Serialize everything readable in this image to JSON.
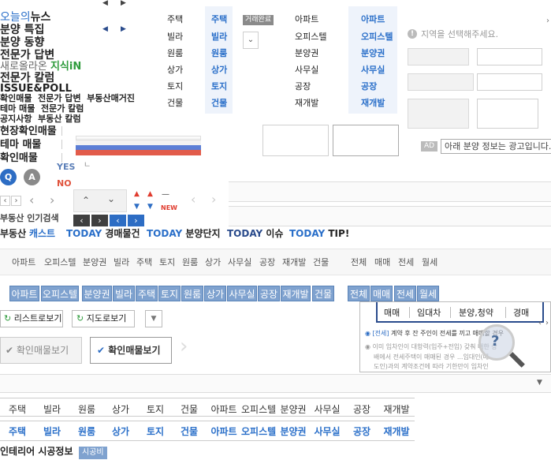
{
  "left_menu": {
    "items": [
      {
        "prefix": "오늘의",
        "label": "뉴스"
      },
      {
        "label": "분양 특집"
      },
      {
        "label": "분양 동향"
      },
      {
        "label": "전문가 답변"
      },
      {
        "prefix": "새로올라온",
        "label": "지식iN"
      },
      {
        "label": "전문가 칼럼"
      },
      {
        "label": "ISSUE&POLL"
      }
    ],
    "subline1": [
      "확인매물",
      "전문가 답변",
      "부동산매거진"
    ],
    "subline2": [
      "테마 매물",
      "전문가 칼럼"
    ],
    "subline3": [
      "공지사항",
      "부동산 칼럼"
    ],
    "sections": [
      "현장확인매물",
      "테마 매물",
      "확인매물"
    ],
    "badges": [
      "Q",
      "A"
    ],
    "yes": "YES",
    "no": "NO",
    "hot_search": "부동산 인기검색",
    "new_label": "NEW"
  },
  "today_bar": {
    "cast_prefix": "부동산",
    "cast_label": "캐스트",
    "items": [
      {
        "today": "TODAY",
        "label": "경매물건"
      },
      {
        "today": "TODAY",
        "label": "분양단지"
      },
      {
        "today": "TODAY",
        "label": "이슈"
      },
      {
        "today": "TODAY",
        "label": "TIP!"
      }
    ]
  },
  "type_grid": {
    "col1": [
      "주택",
      "빌라",
      "원룸",
      "상가",
      "토지",
      "건물"
    ],
    "col2": [
      "주택",
      "빌라",
      "원룸",
      "상가",
      "토지",
      "건물"
    ],
    "complete_label": "거래완료",
    "col3": [
      "아파트",
      "오피스텔",
      "분양권",
      "사무실",
      "공장",
      "재개발"
    ],
    "col4": [
      "아파트",
      "오피스텔",
      "분양권",
      "사무실",
      "공장",
      "재개발"
    ]
  },
  "right_panel": {
    "notice": "지역을 선택해주세요.",
    "ad_badge": "AD",
    "ad_text": "아래 분양 정보는 광고입니다."
  },
  "filter_text": [
    "아파트",
    "오피스텔",
    "분양권",
    "빌라",
    "주택",
    "토지",
    "원룸",
    "상가",
    "사무실",
    "공장",
    "재개발",
    "건물"
  ],
  "deal_text": [
    "전체",
    "매매",
    "전세",
    "월세"
  ],
  "filter_chips": [
    "아파트",
    "오피스텔",
    "분양권",
    "빌라",
    "주택",
    "토지",
    "원룸",
    "상가",
    "사무실",
    "공장",
    "재개발",
    "건물"
  ],
  "deal_chips": [
    "전체",
    "매매",
    "전세",
    "월세"
  ],
  "buttons": {
    "list_view": "리스트로보기",
    "map_view": "지도로보기",
    "verified_gray": "확인매물보기",
    "verified_active": "확인매물보기"
  },
  "info_popup": {
    "tabs": [
      "매매",
      "임대차",
      "분양,청약",
      "경매"
    ],
    "line1_tag": "[전세]",
    "line1": "계약 후 잔 주인이 전세를 끼고 매매할 경우",
    "line2": "이미 임차인이 대항력(입주+전입) 갖춰 대한 상",
    "line3": "배에서 전세주택이 매매된 경우 ...임대인(매",
    "line4": "도인)과의 계약조건에 따라 기한만이 임차인"
  },
  "bottom_table": {
    "row1": [
      "주택",
      "빌라",
      "원룸",
      "상가",
      "토지",
      "건물",
      "아파트",
      "오피스텔",
      "분양권",
      "사무실",
      "공장",
      "재개발"
    ],
    "row2": [
      "주택",
      "빌라",
      "원룸",
      "상가",
      "토지",
      "건물",
      "아파트",
      "오피스텔",
      "분양권",
      "사무실",
      "공장",
      "재개발"
    ]
  },
  "footer": {
    "title": "인테리어 시공정보",
    "badge": "시공비"
  }
}
